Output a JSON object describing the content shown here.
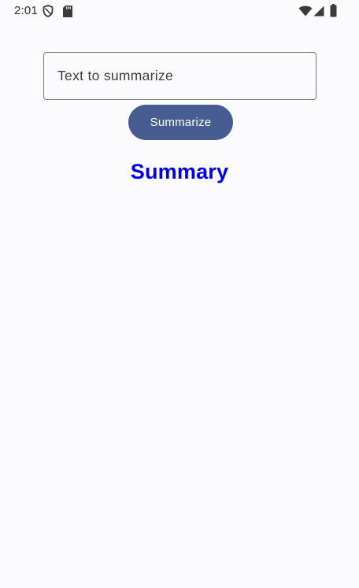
{
  "status_bar": {
    "time": "2:01",
    "left_icons": [
      "shield-icon",
      "sd-card-icon"
    ],
    "right_icons": [
      "wifi-icon",
      "signal-icon",
      "battery-icon"
    ]
  },
  "input": {
    "placeholder": "Text to summarize",
    "value": ""
  },
  "button": {
    "label": "Summarize",
    "color": "#475d92"
  },
  "summary": {
    "heading": "Summary",
    "color": "#0000e6"
  },
  "theme": {
    "background": "#fbfbfd"
  }
}
